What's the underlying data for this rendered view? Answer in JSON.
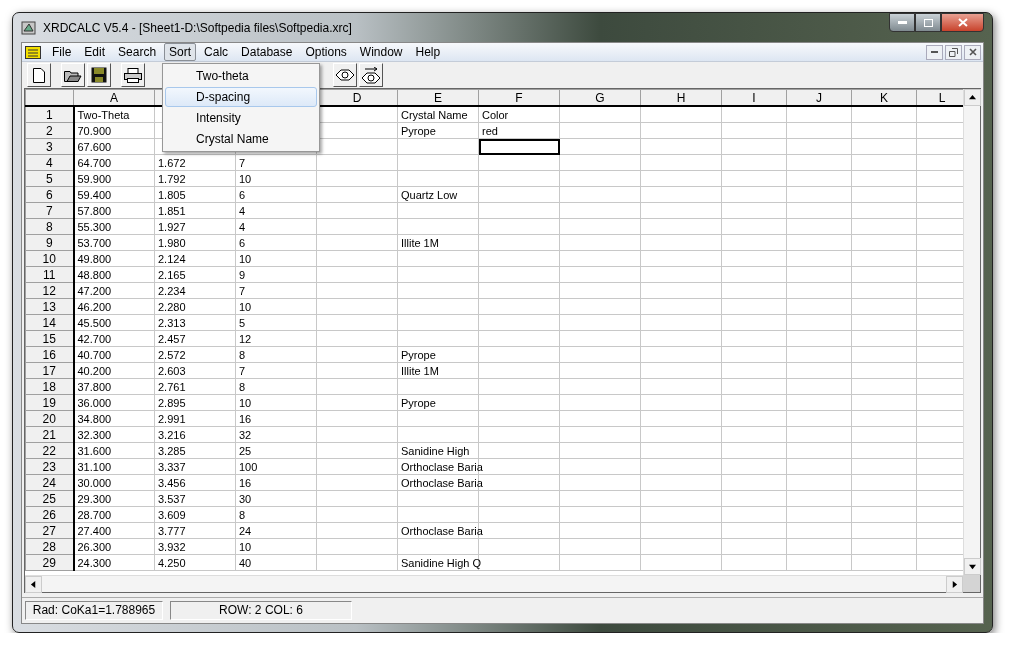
{
  "window": {
    "title": "XRDCALC V5.4 - [Sheet1-D:\\Softpedia files\\Softpedia.xrc]"
  },
  "menu_bar": [
    {
      "label": "File",
      "open": false
    },
    {
      "label": "Edit",
      "open": false
    },
    {
      "label": "Search",
      "open": false
    },
    {
      "label": "Sort",
      "open": true
    },
    {
      "label": "Calc",
      "open": false
    },
    {
      "label": "Database",
      "open": false
    },
    {
      "label": "Options",
      "open": false
    },
    {
      "label": "Window",
      "open": false
    },
    {
      "label": "Help",
      "open": false
    }
  ],
  "sort_menu": {
    "items": [
      {
        "label": "Two-theta",
        "selected": false
      },
      {
        "label": "D-spacing",
        "selected": true
      },
      {
        "label": "Intensity",
        "selected": false
      },
      {
        "label": "Crystal Name",
        "selected": false
      }
    ]
  },
  "sheet": {
    "columns": [
      "A",
      null,
      null,
      "D",
      "E",
      "F",
      "G",
      "H",
      "I",
      "J",
      "K",
      "L"
    ],
    "rows": [
      {
        "header": "1",
        "cells": [
          "Two-Theta",
          null,
          null,
          null,
          "Crystal Name",
          "Color"
        ]
      },
      {
        "header": "2",
        "cells": [
          "70.900",
          null,
          null,
          null,
          "Pyrope",
          "red"
        ]
      },
      {
        "header": "3",
        "cells": [
          "67.600",
          null,
          null,
          null,
          null,
          {
            "selected": true
          }
        ]
      },
      {
        "header": "4",
        "cells": [
          "64.700",
          "1.672",
          "7"
        ]
      },
      {
        "header": "5",
        "cells": [
          "59.900",
          "1.792",
          "10"
        ]
      },
      {
        "header": "6",
        "cells": [
          "59.400",
          "1.805",
          "6",
          null,
          "Quartz Low"
        ]
      },
      {
        "header": "7",
        "cells": [
          "57.800",
          "1.851",
          "4"
        ]
      },
      {
        "header": "8",
        "cells": [
          "55.300",
          "1.927",
          "4"
        ]
      },
      {
        "header": "9",
        "cells": [
          "53.700",
          "1.980",
          "6",
          null,
          "Illite 1M"
        ]
      },
      {
        "header": "10",
        "cells": [
          "49.800",
          "2.124",
          "10"
        ]
      },
      {
        "header": "11",
        "cells": [
          "48.800",
          "2.165",
          "9"
        ]
      },
      {
        "header": "12",
        "cells": [
          "47.200",
          "2.234",
          "7"
        ]
      },
      {
        "header": "13",
        "cells": [
          "46.200",
          "2.280",
          "10"
        ]
      },
      {
        "header": "14",
        "cells": [
          "45.500",
          "2.313",
          "5"
        ]
      },
      {
        "header": "15",
        "cells": [
          "42.700",
          "2.457",
          "12"
        ]
      },
      {
        "header": "16",
        "cells": [
          "40.700",
          "2.572",
          "8",
          null,
          "Pyrope"
        ]
      },
      {
        "header": "17",
        "cells": [
          "40.200",
          "2.603",
          "7",
          null,
          "Illite 1M"
        ]
      },
      {
        "header": "18",
        "cells": [
          "37.800",
          "2.761",
          "8"
        ]
      },
      {
        "header": "19",
        "cells": [
          "36.000",
          "2.895",
          "10",
          null,
          "Pyrope"
        ]
      },
      {
        "header": "20",
        "cells": [
          "34.800",
          "2.991",
          "16"
        ]
      },
      {
        "header": "21",
        "cells": [
          "32.300",
          "3.216",
          "32"
        ]
      },
      {
        "header": "22",
        "cells": [
          "31.600",
          "3.285",
          "25",
          null,
          "Sanidine High"
        ]
      },
      {
        "header": "23",
        "cells": [
          "31.100",
          "3.337",
          "100",
          null,
          "Orthoclase Baria"
        ]
      },
      {
        "header": "24",
        "cells": [
          "30.000",
          "3.456",
          "16",
          null,
          "Orthoclase Baria"
        ]
      },
      {
        "header": "25",
        "cells": [
          "29.300",
          "3.537",
          "30"
        ]
      },
      {
        "header": "26",
        "cells": [
          "28.700",
          "3.609",
          "8"
        ]
      },
      {
        "header": "27",
        "cells": [
          "27.400",
          "3.777",
          "24",
          null,
          "Orthoclase Baria"
        ]
      },
      {
        "header": "28",
        "cells": [
          "26.300",
          "3.932",
          "10"
        ]
      },
      {
        "header": "29",
        "cells": [
          "24.300",
          "4.250",
          "40",
          null,
          "Sanidine High Q"
        ]
      }
    ]
  },
  "status_bar": [
    "Rad: CoKa1=1.788965",
    "ROW: 2  COL: 6"
  ]
}
